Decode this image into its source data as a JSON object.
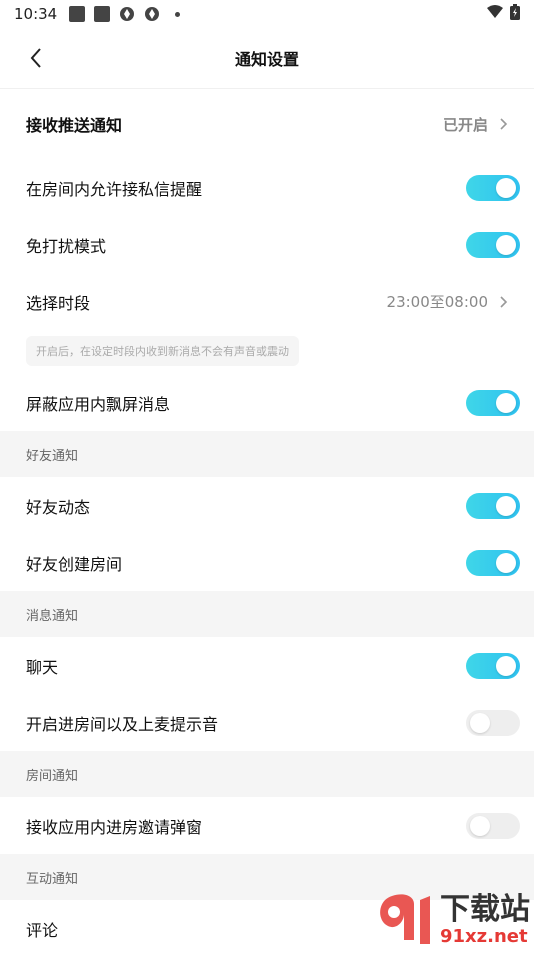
{
  "status_bar": {
    "time": "10:34"
  },
  "header": {
    "title": "通知设置"
  },
  "rows": {
    "receive_push": {
      "label": "接收推送通知",
      "value": "已开启"
    },
    "room_private_msg": {
      "label": "在房间内允许接私信提醒",
      "on": true
    },
    "dnd": {
      "label": "免打扰模式",
      "on": true
    },
    "time_range": {
      "label": "选择时段",
      "value": "23:00至08:00"
    },
    "hint": "开启后，在设定时段内收到新消息不会有声音或震动",
    "block_float": {
      "label": "屏蔽应用内飘屏消息",
      "on": true
    }
  },
  "sections": {
    "friends": {
      "title": "好友通知",
      "items": [
        {
          "label": "好友动态",
          "on": true
        },
        {
          "label": "好友创建房间",
          "on": true
        }
      ]
    },
    "messages": {
      "title": "消息通知",
      "items": [
        {
          "label": "聊天",
          "on": true
        },
        {
          "label": "开启进房间以及上麦提示音",
          "on": false
        }
      ]
    },
    "room": {
      "title": "房间通知",
      "items": [
        {
          "label": "接收应用内进房邀请弹窗",
          "on": false
        }
      ]
    },
    "interaction": {
      "title": "互动通知",
      "items": [
        {
          "label": "评论"
        }
      ]
    }
  },
  "watermark": {
    "cn": "下载站",
    "en": "91xz.net",
    "logo_text": "91"
  },
  "colors": {
    "toggle_on": "#2fc2f0",
    "toggle_off": "#eeeeee",
    "section_bg": "#f5f5f5"
  }
}
